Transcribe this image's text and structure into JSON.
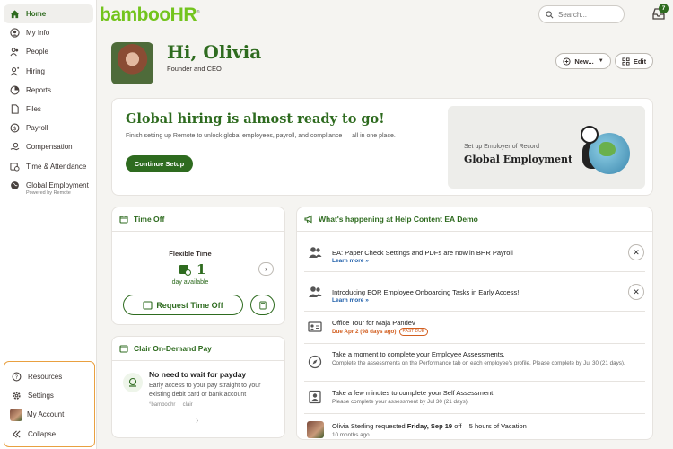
{
  "sidebar": {
    "items": [
      {
        "label": "Home",
        "icon": "home-icon",
        "active": true
      },
      {
        "label": "My Info",
        "icon": "person-circle-icon"
      },
      {
        "label": "People",
        "icon": "people-icon"
      },
      {
        "label": "Hiring",
        "icon": "hiring-icon"
      },
      {
        "label": "Reports",
        "icon": "pie-chart-icon"
      },
      {
        "label": "Files",
        "icon": "file-icon"
      },
      {
        "label": "Payroll",
        "icon": "dollar-circle-icon"
      },
      {
        "label": "Compensation",
        "icon": "hand-coin-icon"
      },
      {
        "label": "Time & Attendance",
        "icon": "clock-calendar-icon"
      },
      {
        "label": "Global Employment",
        "icon": "globe-icon",
        "sublabel": "Powered by Remote"
      }
    ],
    "bottom": [
      {
        "label": "Resources",
        "icon": "question-circle-icon"
      },
      {
        "label": "Settings",
        "icon": "gear-icon"
      },
      {
        "label": "My Account",
        "icon": "avatar"
      },
      {
        "label": "Collapse",
        "icon": "double-chevron-left-icon"
      }
    ]
  },
  "topbar": {
    "logo": "bambooHR",
    "logo_mark": "®",
    "search_placeholder": "Search...",
    "inbox_count": "7"
  },
  "profile": {
    "greeting": "Hi, Olivia",
    "title": "Founder and CEO",
    "new_button": "New...",
    "edit_button": "Edit"
  },
  "hiring_banner": {
    "title": "Global hiring is almost ready to go!",
    "subtitle": "Finish setting up Remote to unlock global employees, payroll, and compliance — all in one place.",
    "button": "Continue Setup",
    "promo_sub": "Set up Employer of Record",
    "promo_title": "Global Employment"
  },
  "time_off": {
    "heading": "Time Off",
    "policy": "Flexible Time",
    "days": "1",
    "days_label": "day available",
    "request_button": "Request Time Off"
  },
  "clair": {
    "heading": "Clair On-Demand Pay",
    "title": "No need to wait for payday",
    "body": "Early access to your pay straight to your existing debit card or bank account",
    "partners": "°bamboohr  |  clair"
  },
  "feed": {
    "heading": "What's happening at Help Content EA Demo",
    "items": [
      {
        "title": "EA: Paper Check Settings and PDFs are now in BHR Payroll",
        "link": "Learn more »"
      },
      {
        "title": "Introducing EOR Employee Onboarding Tasks in Early Access!",
        "link": "Learn more »"
      },
      {
        "title": "Office Tour for Maja Pandev",
        "due": "Due Apr 2 (98 days ago)",
        "badge": "PAST DUE"
      },
      {
        "title": "Take a moment to complete your Employee Assessments.",
        "detail": "Complete the assessments on the Performance tab on each employee's profile. Please complete by Jul 30 (21 days)."
      },
      {
        "title": "Take a few minutes to complete your Self Assessment.",
        "detail": "Please complete your assessment by Jul 30 (21 days)."
      },
      {
        "title_prefix": "Olivia Sterling requested ",
        "title_bold": "Friday, Sep 19",
        "title_suffix": " off – 5 hours of Vacation",
        "detail": "10 months ago"
      }
    ]
  },
  "colors": {
    "brand_green": "#2e6b1f",
    "logo_green": "#73c41d",
    "highlight_orange": "#e9a040",
    "past_due": "#d25e1f"
  }
}
